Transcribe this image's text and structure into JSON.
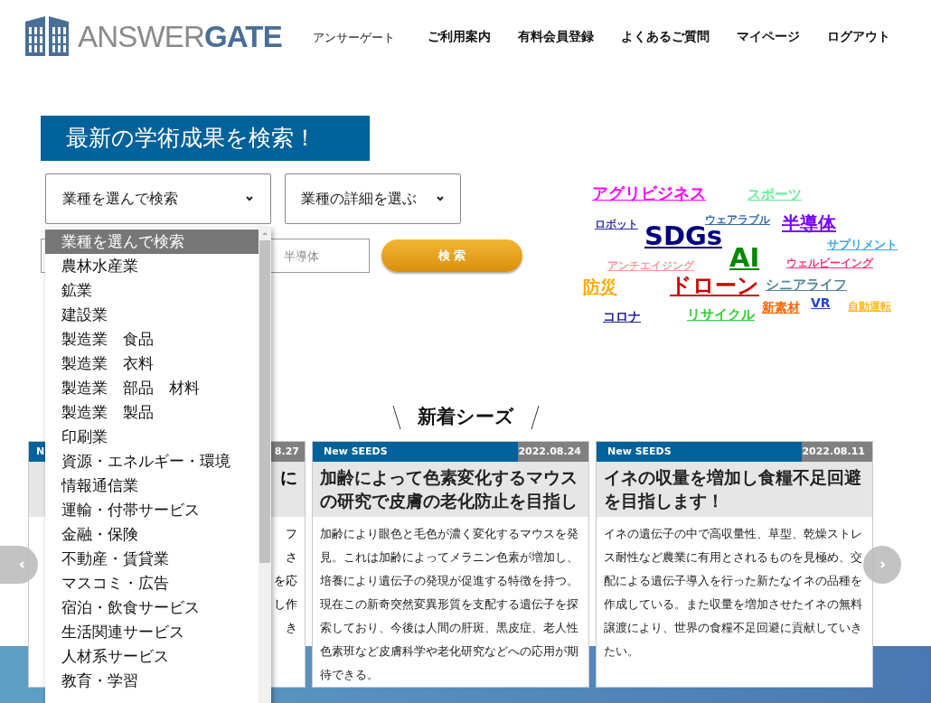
{
  "header": {
    "logo": {
      "light": "ANSWER",
      "bold": "GATE"
    },
    "tagline": "アンサーゲート",
    "nav": [
      "ご利用案内",
      "有料会員登録",
      "よくあるご質問",
      "マイページ",
      "ログアウト"
    ]
  },
  "search": {
    "heading": "最新の学術成果を検索！",
    "industry_select": "業種を選んで検索",
    "detail_select": "業種の詳細を選ぶ",
    "keyword_placeholder": "半導体",
    "button": "検 索",
    "dropdown": [
      {
        "label": "業種を選んで検索",
        "selected": true
      },
      {
        "label": "農林水産業",
        "selected": false
      },
      {
        "label": "鉱業",
        "selected": false
      },
      {
        "label": "建設業",
        "selected": false
      },
      {
        "label": "製造業　食品",
        "selected": false
      },
      {
        "label": "製造業　衣料",
        "selected": false
      },
      {
        "label": "製造業　部品　材料",
        "selected": false
      },
      {
        "label": "製造業　製品",
        "selected": false
      },
      {
        "label": "印刷業",
        "selected": false
      },
      {
        "label": "資源・エネルギー・環境",
        "selected": false
      },
      {
        "label": "情報通信業",
        "selected": false
      },
      {
        "label": "運輸・付帯サービス",
        "selected": false
      },
      {
        "label": "金融・保険",
        "selected": false
      },
      {
        "label": "不動産・賃貸業",
        "selected": false
      },
      {
        "label": "マスコミ・広告",
        "selected": false
      },
      {
        "label": "宿泊・飲食サービス",
        "selected": false
      },
      {
        "label": "生活関連サービス",
        "selected": false
      },
      {
        "label": "人材系サービス",
        "selected": false
      },
      {
        "label": "教育・学習",
        "selected": false
      }
    ]
  },
  "tag_cloud": [
    {
      "label": "アグリビジネス",
      "color": "#ff00ff"
    },
    {
      "label": "スポーツ",
      "color": "#66ee99"
    },
    {
      "label": "ロボット",
      "color": "#3333aa"
    },
    {
      "label": "ウェアラブル",
      "color": "#3366aa"
    },
    {
      "label": "半導体",
      "color": "#7700ff"
    },
    {
      "label": "SDGs",
      "color": "#000080"
    },
    {
      "label": "サプリメント",
      "color": "#33aaee"
    },
    {
      "label": "アンチエイジング",
      "color": "#ff9999"
    },
    {
      "label": "AI",
      "color": "#008800"
    },
    {
      "label": "ウェルビーイング",
      "color": "#ff3377"
    },
    {
      "label": "防災",
      "color": "#ffaa00"
    },
    {
      "label": "ドローン",
      "color": "#cc0000"
    },
    {
      "label": "シニアライフ",
      "color": "#558899"
    },
    {
      "label": "コロナ",
      "color": "#222299"
    },
    {
      "label": "リサイクル",
      "color": "#33cc33"
    },
    {
      "label": "新素材",
      "color": "#ff6600"
    },
    {
      "label": "VR",
      "color": "#2244cc"
    },
    {
      "label": "自動運転",
      "color": "#ffbb22"
    }
  ],
  "new_seeds": {
    "heading": "新着シーズ",
    "partial_card": {
      "badge": "N",
      "date": "8.27",
      "title_right": [
        "に"
      ],
      "body_right": [
        "フ",
        "さ",
        "を応",
        "し作",
        "き"
      ]
    },
    "cards": [
      {
        "badge": "New SEEDS",
        "date": "2022.08.24",
        "title": "加齢によって色素変化するマウスの研究で皮膚の老化防止を目指し",
        "body": "加齢により眼色と毛色が濃く変化するマウスを発見。これは加齢によってメラニン色素が増加し、培養により遺伝子の発現が促進する特徴を持つ。現在この新奇突然変異形質を支配する遺伝子を探索しており、今後は人間の肝斑、黒皮症、老人性色素班など皮膚科学や老化研究などへの応用が期待できる。"
      },
      {
        "badge": "New SEEDS",
        "date": "2022.08.11",
        "title": "イネの収量を増加し食糧不足回避を目指します！",
        "body": "イネの遺伝子の中で高収量性、草型、乾燥ストレス耐性など農業に有用とされるものを見極め、交配による遺伝子導入を行った新たなイネの品種を作成している。また収量を増加させたイネの無料譲渡により、世界の食糧不足回避に貢献していきたい。"
      }
    ]
  }
}
